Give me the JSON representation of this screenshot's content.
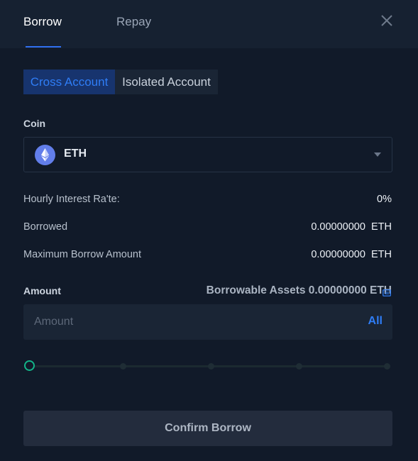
{
  "header": {
    "tabs": [
      {
        "label": "Borrow",
        "active": true
      },
      {
        "label": "Repay",
        "active": false
      }
    ]
  },
  "account_switch": {
    "options": [
      {
        "label": "Cross Account",
        "active": true
      },
      {
        "label": "Isolated Account",
        "active": false
      }
    ]
  },
  "coin": {
    "label": "Coin",
    "selected": "ETH",
    "icon": "ethereum-icon"
  },
  "info": {
    "hourly_rate": {
      "label": "Hourly Interest Ra'te:",
      "value": "0%"
    },
    "borrowed": {
      "label": "Borrowed",
      "value": "0.00000000  ETH"
    },
    "max_borrow": {
      "label": "Maximum Borrow Amount",
      "value": "0.00000000  ETH"
    }
  },
  "amount": {
    "label": "Amount",
    "borrowable_text": "Borrowable Assets 0.00000000 ETH",
    "placeholder": "Amount",
    "value": "",
    "all_label": "All",
    "slider_percent": 0
  },
  "confirm_label": "Confirm Borrow",
  "colors": {
    "accent": "#2f7df6",
    "slider_handle": "#13b589",
    "background": "#111a29",
    "header": "#162131"
  }
}
